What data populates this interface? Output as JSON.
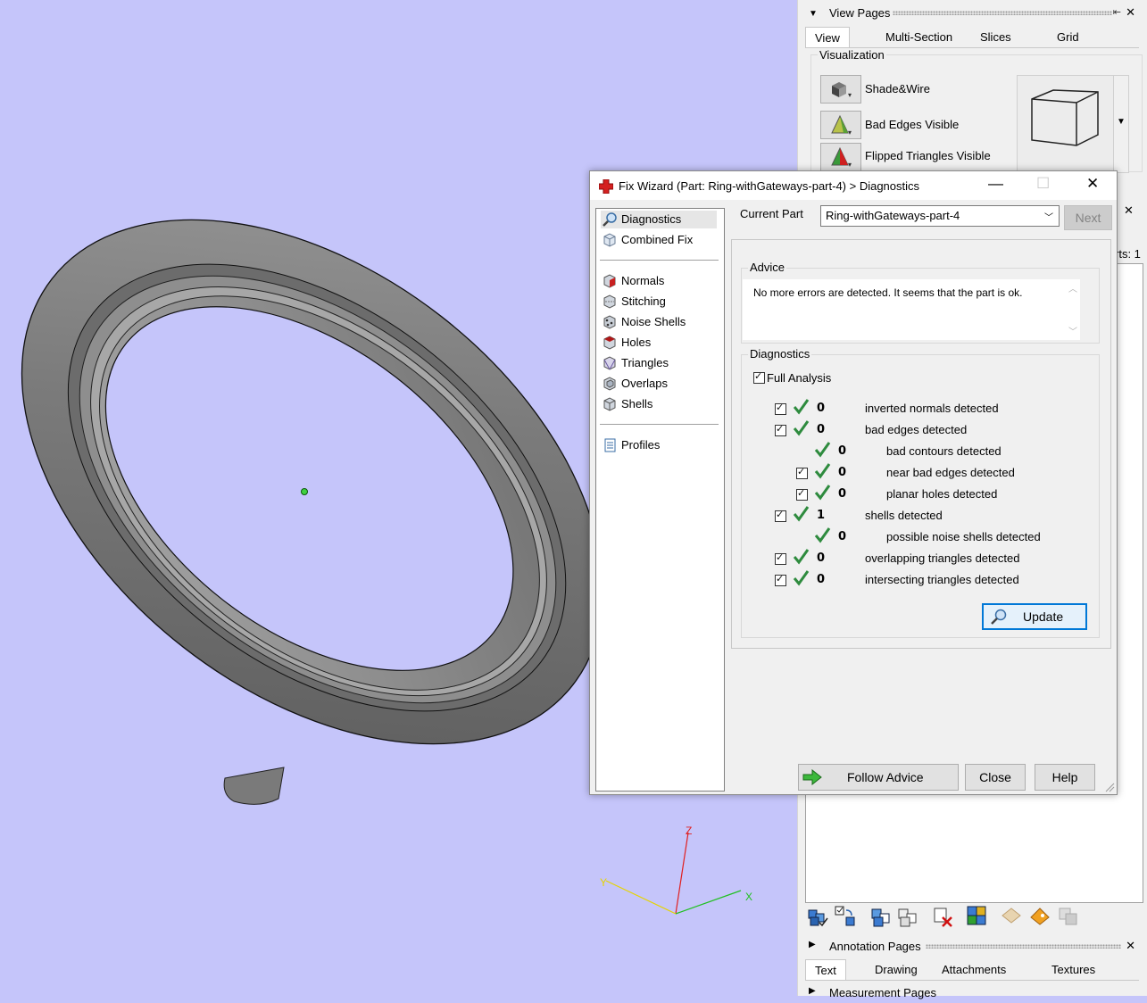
{
  "viewport": {
    "axis_labels": {
      "x": "X",
      "y": "Y",
      "z": "Z"
    }
  },
  "view_pages": {
    "title": "View Pages",
    "tabs": [
      "View",
      "Multi-Section",
      "Slices",
      "Grid"
    ],
    "active_tab": "View",
    "visualization": {
      "legend": "Visualization",
      "items": [
        {
          "label": "Shade&Wire",
          "icon": "shade-wire-icon"
        },
        {
          "label": "Bad Edges Visible",
          "icon": "bad-edges-icon"
        },
        {
          "label": "Flipped Triangles Visible",
          "icon": "flipped-triangles-icon"
        }
      ]
    }
  },
  "hidden_panel": {
    "partial_text": "rts: 1"
  },
  "annotation_pages": {
    "title": "Annotation Pages",
    "tabs": [
      "Text",
      "Drawing",
      "Attachments",
      "Textures"
    ],
    "active_tab": "Text"
  },
  "measurement_pages": {
    "title": "Measurement Pages"
  },
  "dialog": {
    "title": "Fix Wizard (Part: Ring-withGateways-part-4) > Diagnostics",
    "nav": {
      "top": [
        {
          "label": "Diagnostics",
          "icon": "magnifier-icon",
          "selected": true
        },
        {
          "label": "Combined Fix",
          "icon": "combined-fix-icon"
        }
      ],
      "fixes": [
        {
          "label": "Normals",
          "icon": "normals-icon"
        },
        {
          "label": "Stitching",
          "icon": "stitching-icon"
        },
        {
          "label": "Noise Shells",
          "icon": "noise-shells-icon"
        },
        {
          "label": "Holes",
          "icon": "holes-icon"
        },
        {
          "label": "Triangles",
          "icon": "triangles-icon"
        },
        {
          "label": "Overlaps",
          "icon": "overlaps-icon"
        },
        {
          "label": "Shells",
          "icon": "shells-icon"
        }
      ],
      "bottom": [
        {
          "label": "Profiles",
          "icon": "profiles-icon"
        }
      ]
    },
    "current_part_label": "Current Part",
    "current_part_value": "Ring-withGateways-part-4",
    "next_label": "Next",
    "advice": {
      "legend": "Advice",
      "text": "No more errors are detected. It seems that the part is ok."
    },
    "diagnostics": {
      "legend": "Diagnostics",
      "full_analysis_label": "Full Analysis",
      "rows": [
        {
          "count": "0",
          "text": "inverted normals detected",
          "indent": 0,
          "checkbox": true
        },
        {
          "count": "0",
          "text": "bad edges detected",
          "indent": 0,
          "checkbox": true
        },
        {
          "count": "0",
          "text": "bad contours detected",
          "indent": 1,
          "checkbox": false
        },
        {
          "count": "0",
          "text": "near bad edges detected",
          "indent": 1,
          "checkbox": true
        },
        {
          "count": "0",
          "text": "planar holes detected",
          "indent": 1,
          "checkbox": true
        },
        {
          "count": "1",
          "text": "shells detected",
          "indent": 0,
          "checkbox": true
        },
        {
          "count": "0",
          "text": "possible noise shells detected",
          "indent": 1,
          "checkbox": false
        },
        {
          "count": "0",
          "text": "overlapping triangles detected",
          "indent": 0,
          "checkbox": true
        },
        {
          "count": "0",
          "text": "intersecting triangles detected",
          "indent": 0,
          "checkbox": true
        }
      ],
      "update_label": "Update"
    },
    "buttons": {
      "follow_advice": "Follow Advice",
      "close": "Close",
      "help": "Help"
    }
  },
  "colors": {
    "viewport_bg": "#c5c5fa",
    "check_green": "#2e8b3e",
    "focus_blue": "#0078d7"
  }
}
